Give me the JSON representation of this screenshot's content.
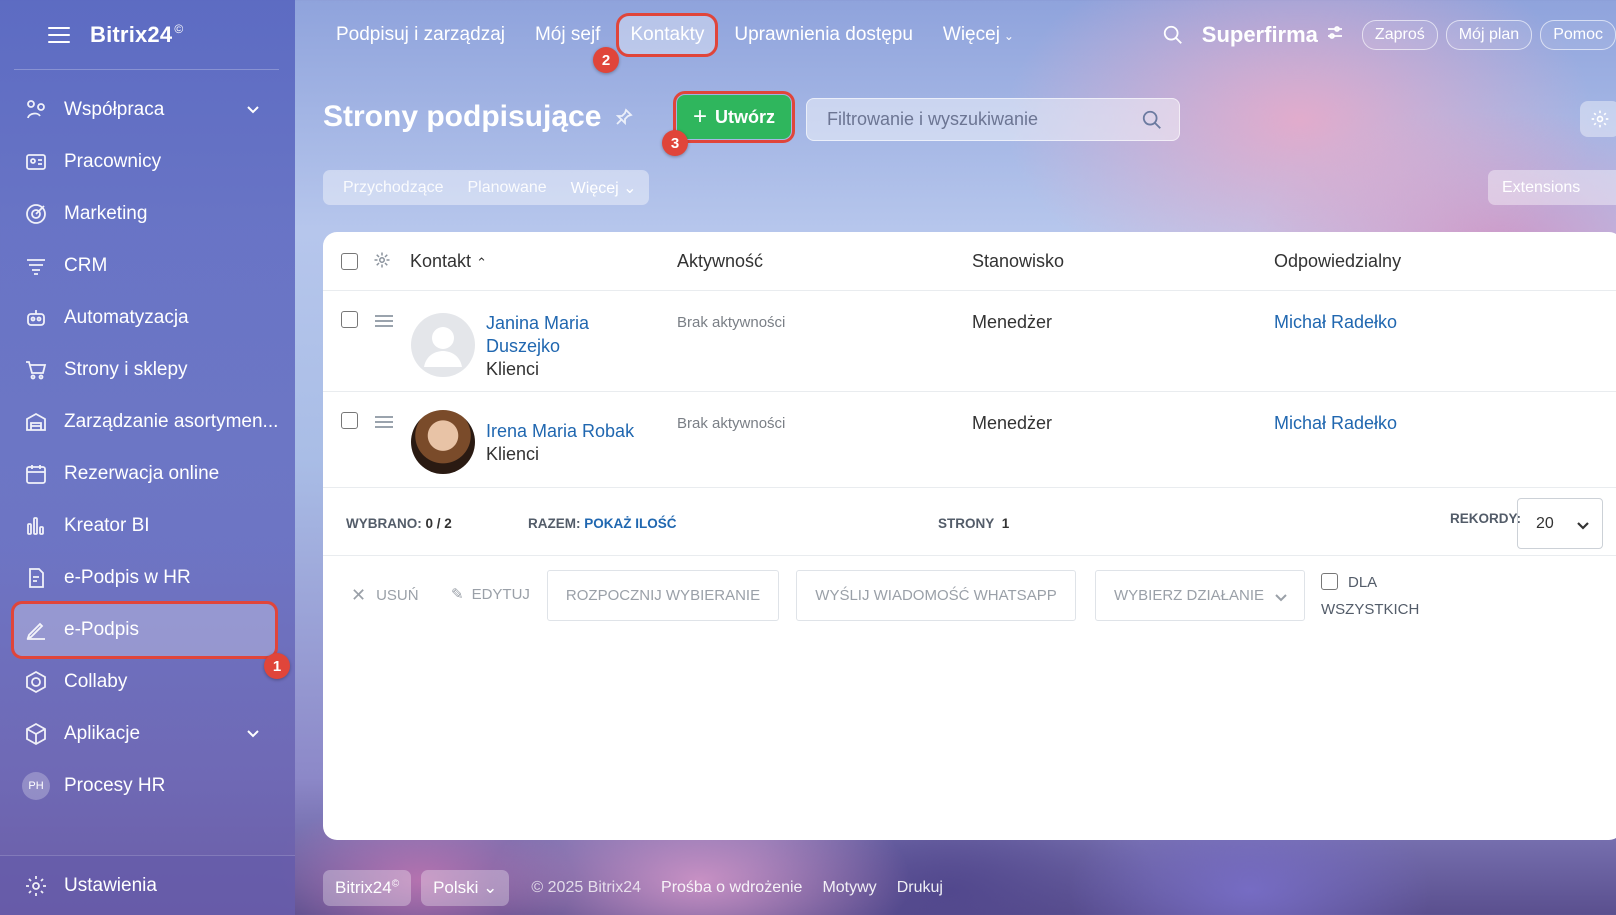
{
  "app": {
    "logo": "Bitrix24",
    "logo_mark": "©"
  },
  "sidebar": {
    "items": [
      {
        "label": "Współpraca",
        "icon": "collab-icon",
        "chevron": true
      },
      {
        "label": "Pracownicy",
        "icon": "employees-icon"
      },
      {
        "label": "Marketing",
        "icon": "marketing-icon"
      },
      {
        "label": "CRM",
        "icon": "crm-icon"
      },
      {
        "label": "Automatyzacja",
        "icon": "automation-icon"
      },
      {
        "label": "Strony i sklepy",
        "icon": "cart-icon"
      },
      {
        "label": "Zarządzanie asortymen...",
        "icon": "warehouse-icon"
      },
      {
        "label": "Rezerwacja online",
        "icon": "calendar-icon"
      },
      {
        "label": "Kreator BI",
        "icon": "chart-icon"
      },
      {
        "label": "e-Podpis w HR",
        "icon": "document-sign-icon"
      },
      {
        "label": "e-Podpis",
        "icon": "pen-icon",
        "active": true
      },
      {
        "label": "Collaby",
        "icon": "hexagon-icon"
      },
      {
        "label": "Aplikacje",
        "icon": "box-icon",
        "chevron": true
      },
      {
        "label": "Procesy HR",
        "avatar": "PH"
      }
    ],
    "settings_label": "Ustawienia"
  },
  "topbar": {
    "tabs": [
      "Podpisuj i zarządzaj",
      "Mój sejf",
      "Kontakty",
      "Uprawnienia dostępu",
      "Więcej"
    ],
    "active_tab": "Kontakty",
    "company": "Superfirma",
    "pills": [
      "Zaproś",
      "Mój plan",
      "Pomoc"
    ]
  },
  "page": {
    "title": "Strony podpisujące",
    "create_label": "Utwórz",
    "filter_placeholder": "Filtrowanie i wyszukiwanie",
    "subtabs": [
      "Przychodzące",
      "Planowane",
      "Więcej"
    ],
    "extensions_label": "Extensions"
  },
  "table": {
    "columns": [
      "Kontakt",
      "Aktywność",
      "Stanowisko",
      "Odpowiedzialny"
    ],
    "rows": [
      {
        "name_line1": "Janina Maria",
        "name_line2": "Duszejko",
        "type": "Klienci",
        "activity": "Brak aktywności",
        "position": "Menedżer",
        "responsible": "Michał Radełko"
      },
      {
        "name_line1": "Irena Maria Robak",
        "name_line2": "",
        "type": "Klienci",
        "activity": "Brak aktywności",
        "position": "Menedżer",
        "responsible": "Michał Radełko"
      }
    ],
    "footer": {
      "selected_label": "WYBRANO:",
      "selected_value": "0 / 2",
      "total_label": "RAZEM:",
      "total_link": "POKAŻ ILOŚĆ",
      "pages_label": "STRONY",
      "pages_value": "1",
      "records_label": "REKORDY:",
      "records_value": "20"
    },
    "actions": {
      "delete": "USUŃ",
      "edit": "EDYTUJ",
      "dial": "ROZPOCZNIJ WYBIERANIE",
      "whatsapp": "WYŚLIJ WIADOMOŚĆ WHATSAPP",
      "choose": "WYBIERZ DZIAŁANIE",
      "for_all_1": "DLA",
      "for_all_2": "WSZYSTKICH"
    }
  },
  "footer": {
    "brand": "Bitrix24",
    "language": "Polski",
    "copyright": "© 2025 Bitrix24",
    "links": [
      "Prośba o wdrożenie",
      "Motywy",
      "Drukuj"
    ]
  },
  "badges": [
    "1",
    "2",
    "3"
  ],
  "colors": {
    "accent_green": "#2fb65d",
    "highlight_red": "#e0453a",
    "link_blue": "#2067b0"
  }
}
